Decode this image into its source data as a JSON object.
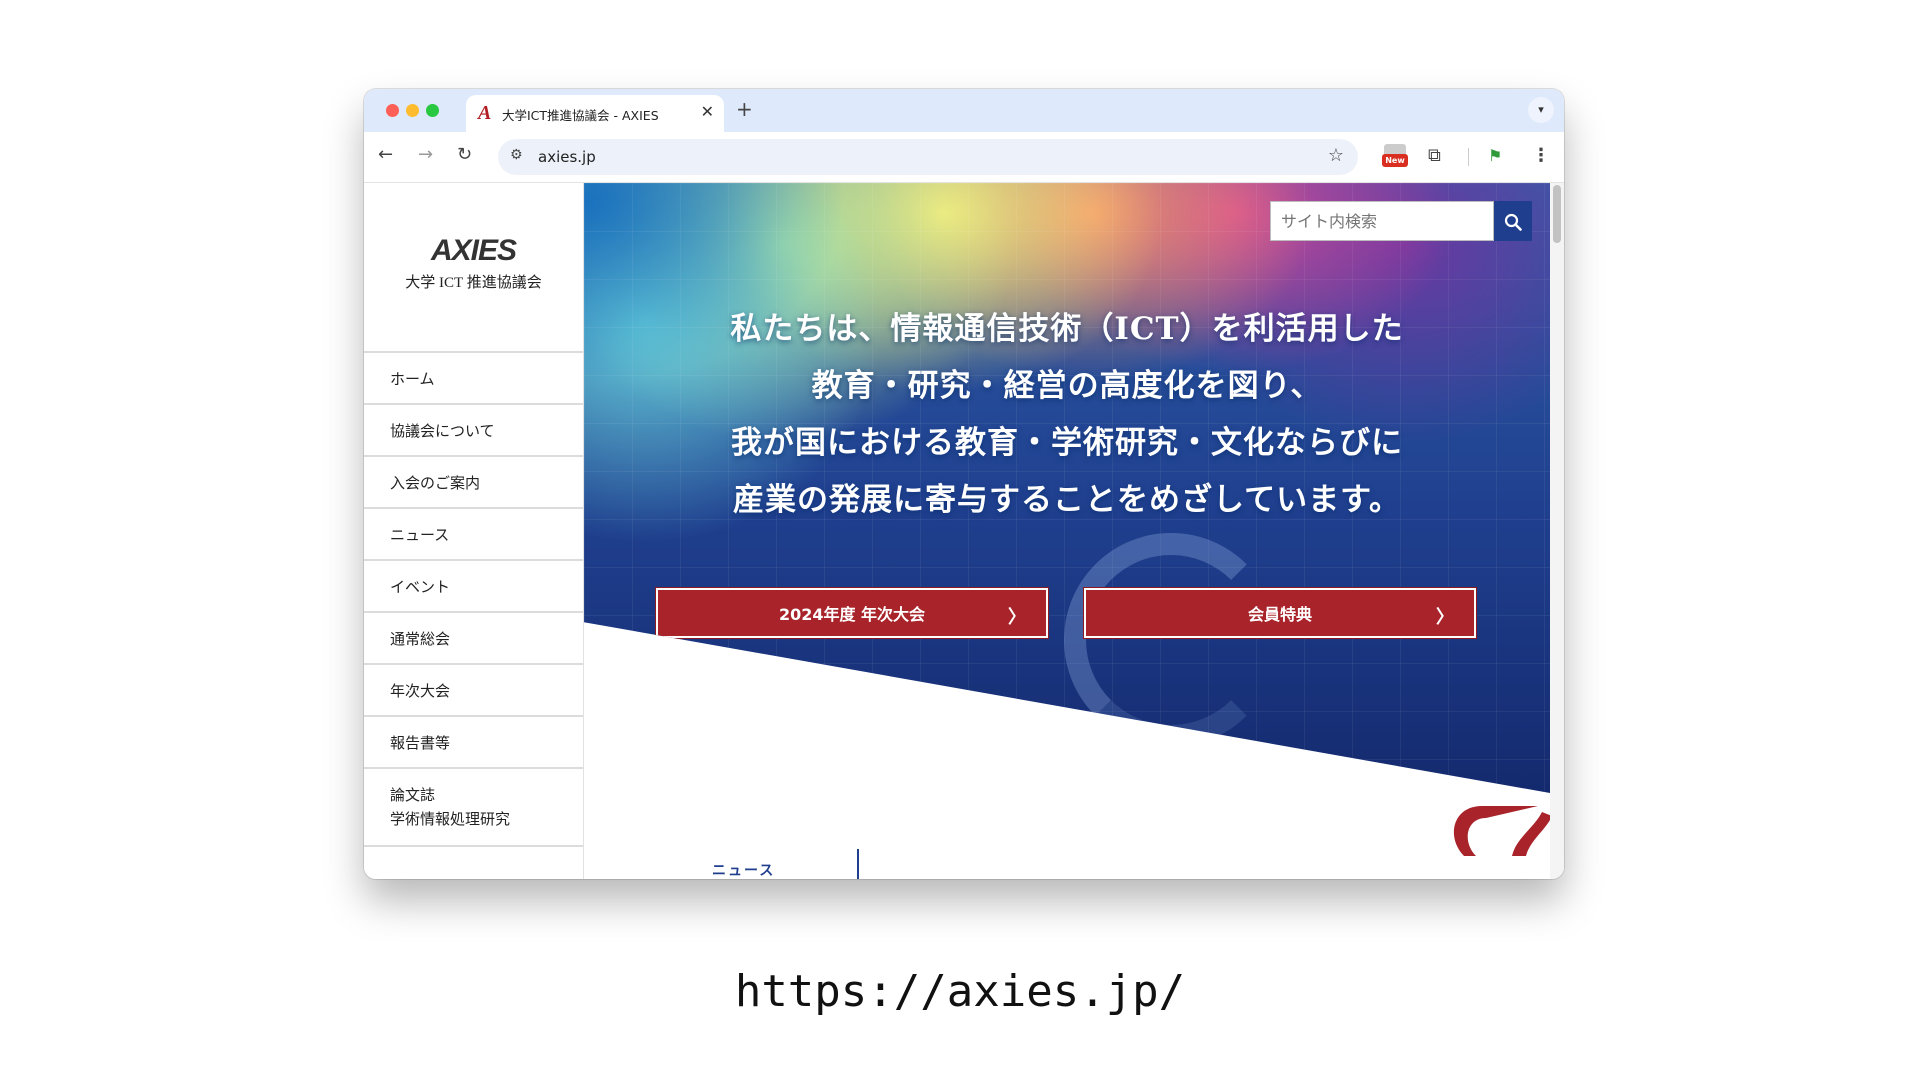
{
  "browser": {
    "tab_title": "大学ICT推進協議会 - AXIES",
    "tab_close": "✕",
    "new_tab": "+",
    "url": "axies.jp",
    "new_badge": "New"
  },
  "site": {
    "logo_text": "AXIES",
    "logo_sub": "大学 ICT 推進協議会",
    "search_placeholder": "サイト内検索",
    "menu": [
      {
        "label": "ホーム"
      },
      {
        "label": "協議会について"
      },
      {
        "label": "入会のご案内"
      },
      {
        "label": "ニュース"
      },
      {
        "label": "イベント"
      },
      {
        "label": "通常総会"
      },
      {
        "label": "年次大会"
      },
      {
        "label": "報告書等"
      },
      {
        "label": "論文誌",
        "label2": "学術情報処理研究"
      }
    ],
    "headline": [
      "私たちは、情報通信技術（ICT）を利活用した",
      "教育・研究・経営の高度化を図り、",
      "我が国における教育・学術研究・文化ならびに",
      "産業の発展に寄与することをめざしています。"
    ],
    "cta1": "2024年度 年次大会",
    "cta2": "会員特典",
    "chevron": "〉",
    "news_label": "ニュース"
  },
  "caption": "https://axies.jp/",
  "colors": {
    "accent_red": "#a8242a",
    "brand_navy": "#1f3f8e",
    "tab_strip": "#dee9fb"
  },
  "icons": [
    "back-icon",
    "forward-icon",
    "reload-icon",
    "site-info-icon",
    "star-icon",
    "puzzle-icon",
    "menu-icon",
    "search-icon",
    "chevron-right-icon"
  ]
}
